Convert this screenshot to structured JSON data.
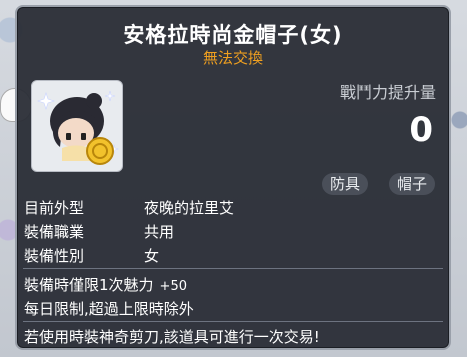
{
  "item": {
    "title": "安格拉時尚金帽子(女)",
    "trade_status": "無法交換",
    "stat_label": "戰鬥力提升量",
    "stat_value": "0",
    "tags": [
      "防具",
      "帽子"
    ]
  },
  "details": [
    {
      "key": "目前外型",
      "value": "夜晚的拉里艾"
    },
    {
      "key": "裝備職業",
      "value": "共用"
    },
    {
      "key": "裝備性別",
      "value": "女"
    }
  ],
  "limit": {
    "text": "裝備時僅限1次魅力",
    "bonus": "+50"
  },
  "daily": "每日限制,超過上限時除外",
  "scissor_note": "若使用時裝神奇剪刀,該道具可進行一次交易!",
  "colors": {
    "background": "#282c34",
    "trade_status": "#f0a020",
    "text": "#ffffff"
  }
}
